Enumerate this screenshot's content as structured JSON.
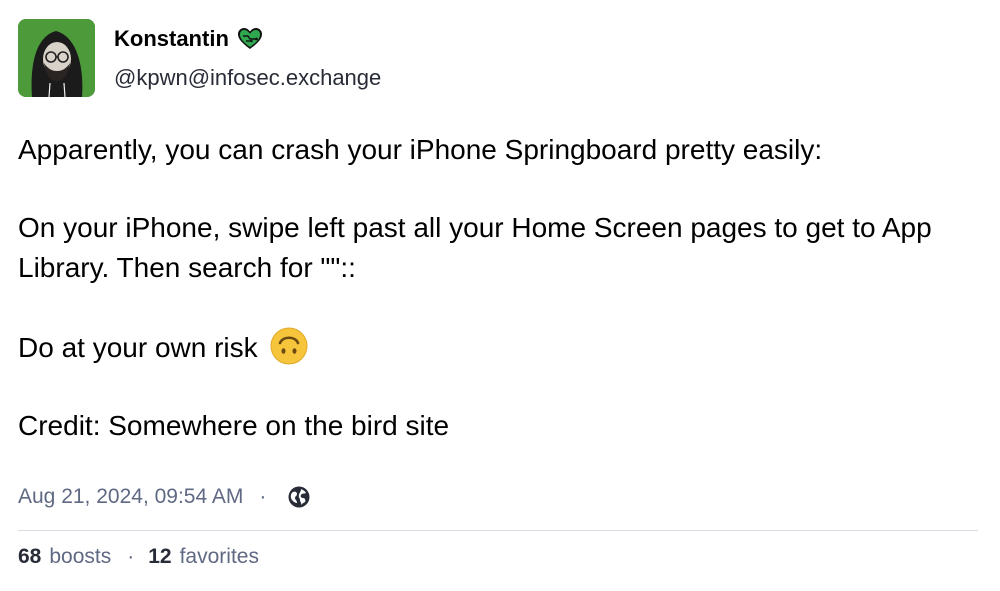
{
  "account": {
    "display_name": "Konstantin",
    "handle": "@kpwn@infosec.exchange",
    "avatar": "avatar-hooded-person",
    "name_emoji": "green-heart-circuit-emoji"
  },
  "post": {
    "paragraphs": [
      "Apparently, you can crash your iPhone Springboard pretty easily:",
      "On your iPhone, swipe left past all your Home Screen pages to get to App Library. Then search for \"\"::",
      "Do at your own risk",
      "Credit: Somewhere on the bird site"
    ],
    "risk_emoji": "upside-down-face-emoji",
    "timestamp": "Aug 21, 2024, 09:54 AM",
    "separator": "·",
    "visibility_icon": "globe-icon"
  },
  "stats": {
    "boosts_count": "68",
    "boosts_label": "boosts",
    "favorites_count": "12",
    "favorites_label": "favorites",
    "separator": "·"
  },
  "colors": {
    "meta_text": "#606984",
    "divider": "#d9dbe2",
    "avatar_bg": "#4c9a3a"
  }
}
